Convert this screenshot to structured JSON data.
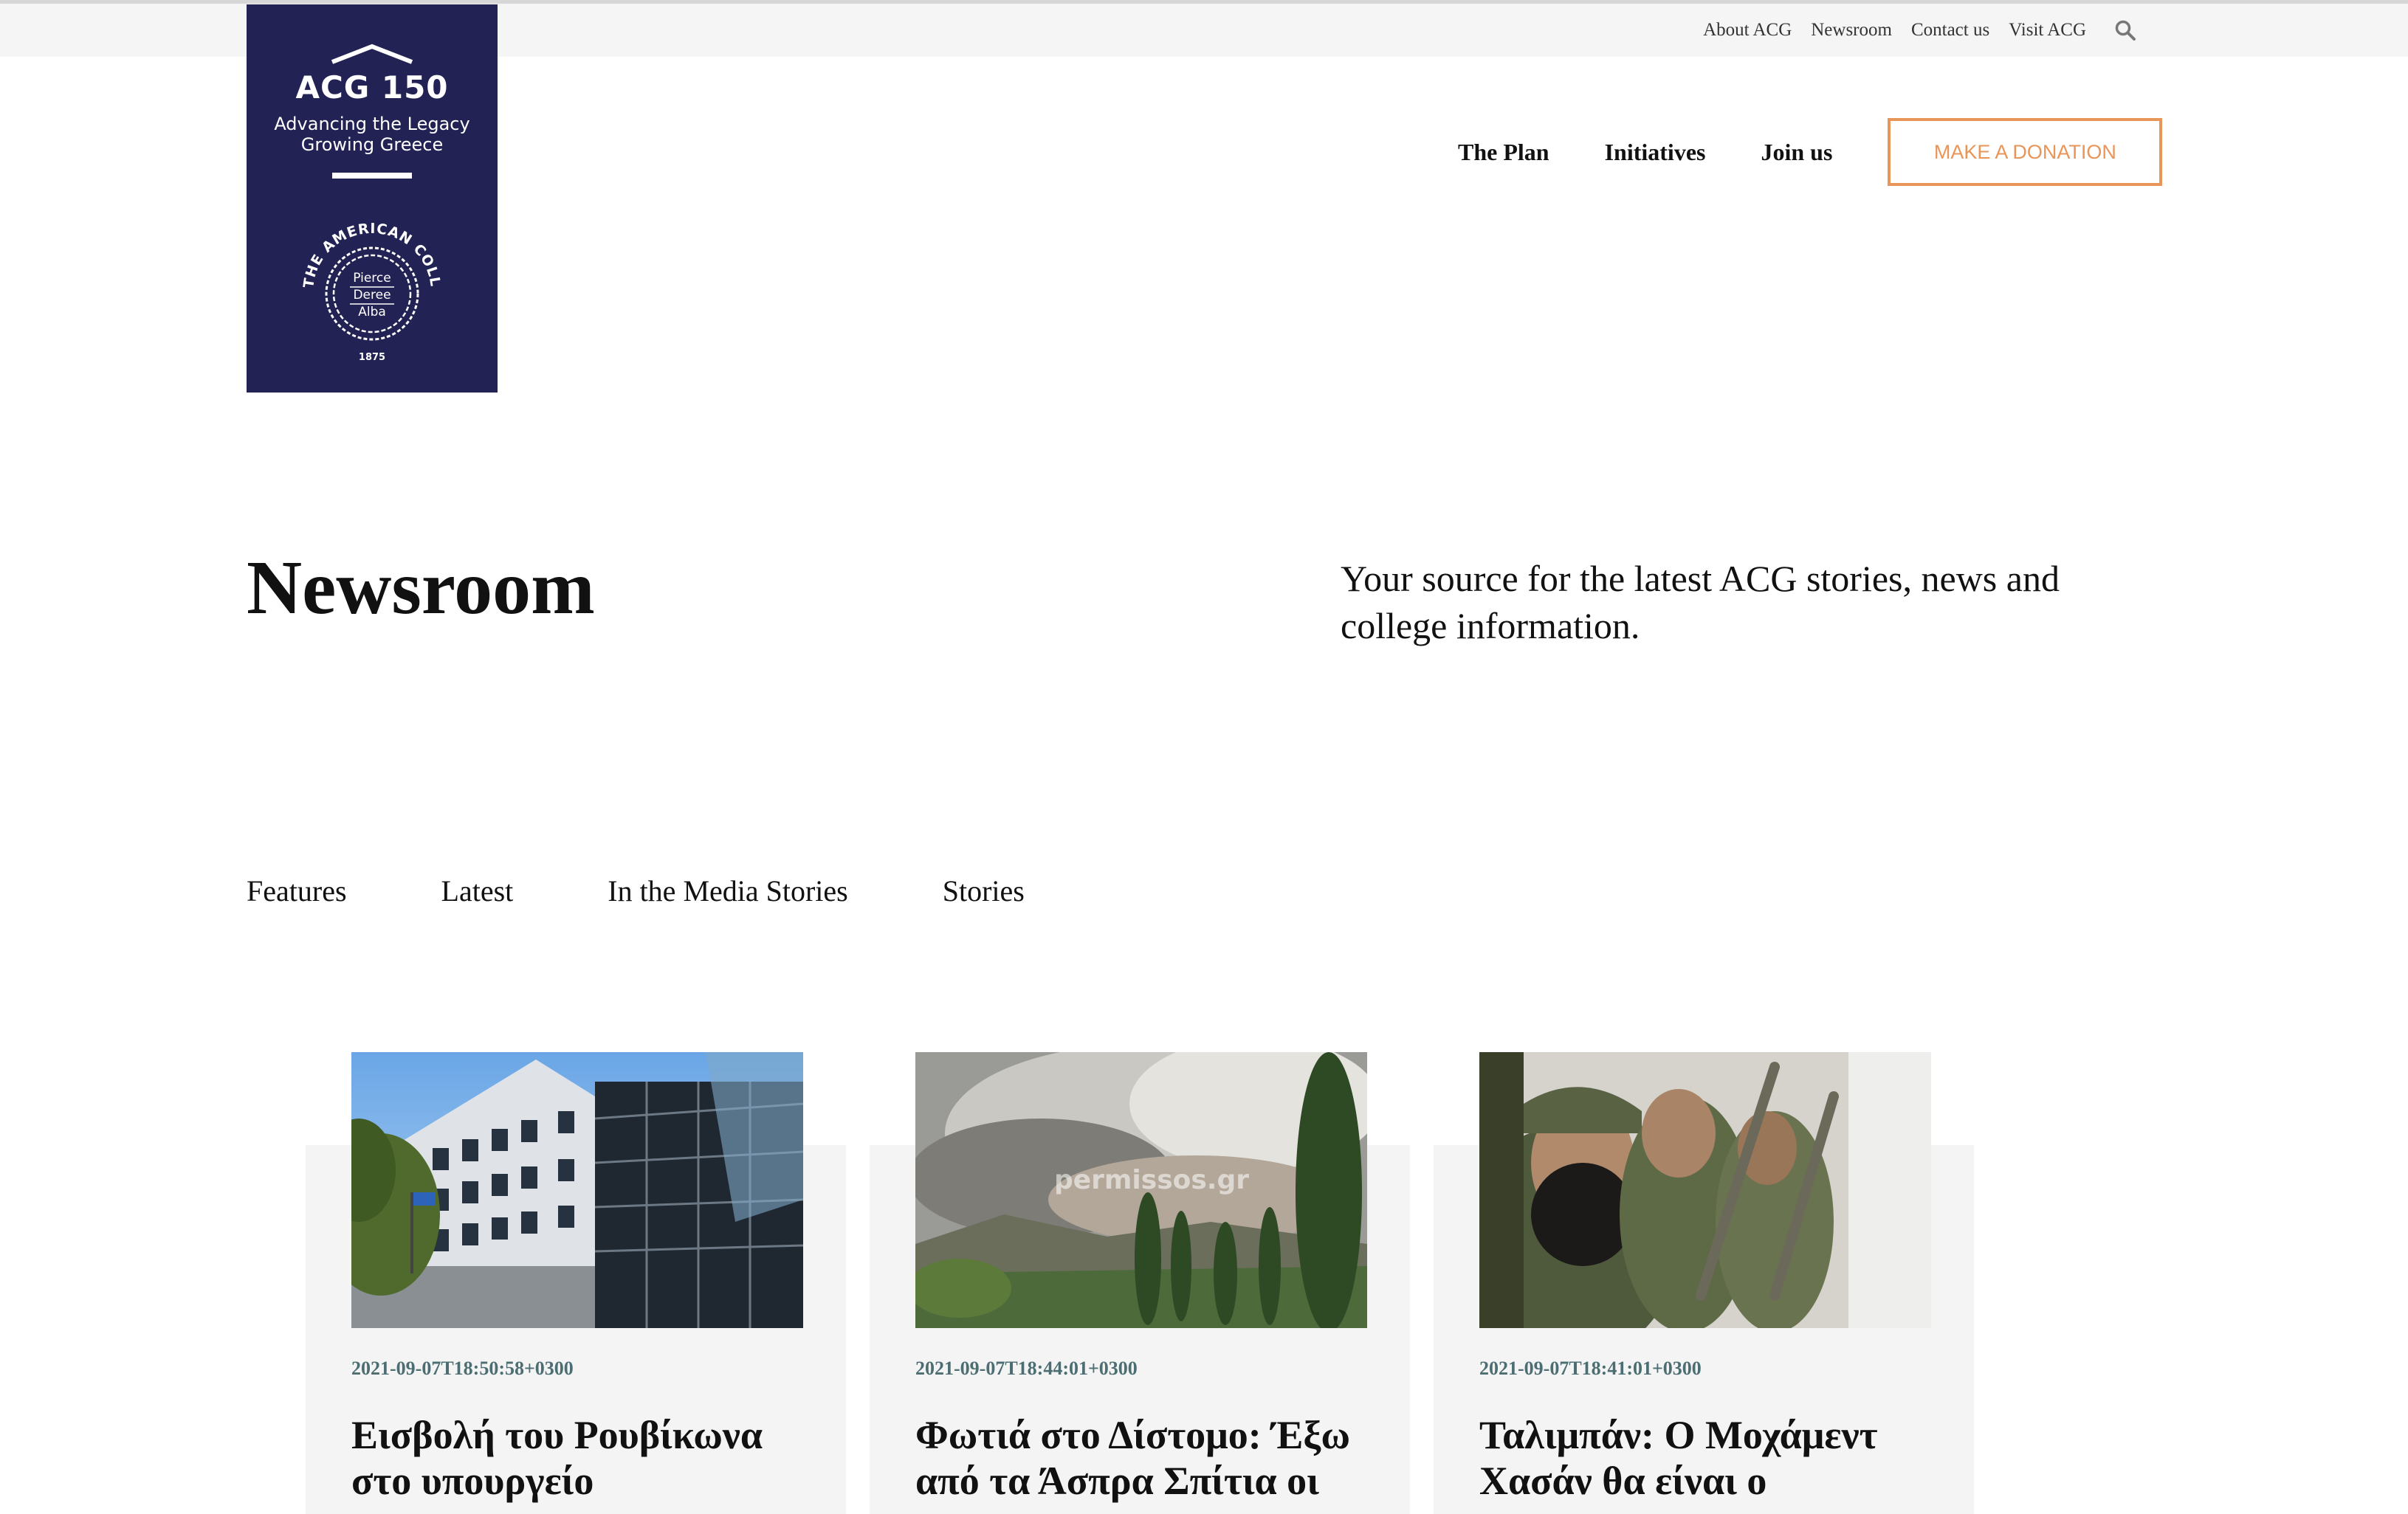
{
  "utility_nav": {
    "items": [
      "About ACG",
      "Newsroom",
      "Contact us",
      "Visit ACG"
    ],
    "search_icon": "search-icon"
  },
  "logo": {
    "brand": "ACG 150",
    "tagline_1": "Advancing the Legacy",
    "tagline_2": "Growing Greece",
    "seal_ring_text": "THE AMERICAN COLLEGE OF GREECE",
    "seal_line_1": "Pierce",
    "seal_line_2": "Deree",
    "seal_line_3": "Alba",
    "seal_year": "1875",
    "colors": {
      "background": "#222255",
      "foreground": "#ffffff"
    }
  },
  "main_nav": {
    "items": [
      "The Plan",
      "Initiatives",
      "Join us"
    ],
    "donate_label": "MAKE A DONATION",
    "donate_color": "#e8955a"
  },
  "header": {
    "title": "Newsroom",
    "description": "Your source for the latest ACG stories, news and college information."
  },
  "tabs": [
    "Features",
    "Latest",
    "In the Media Stories",
    "Stories"
  ],
  "cards": [
    {
      "image": "office-building-photo",
      "date": "2021-09-07T18:50:58+0300",
      "title": "Εισβολή του Ρουβίκωνα στο υπουργείο"
    },
    {
      "image": "wildfire-smoke-photo",
      "image_watermark": "permissos.gr",
      "date": "2021-09-07T18:44:01+0300",
      "title": "Φωτιά στο Δίστομο: Έξω από τα Άσπρα Σπίτια οι"
    },
    {
      "image": "armed-fighters-photo",
      "date": "2021-09-07T18:41:01+0300",
      "title": "Ταλιμπάν: Ο Μοχάμεντ Χασάν θα είναι ο"
    }
  ],
  "colors": {
    "accent": "#e8955a",
    "date_text": "#4c6e72",
    "card_bg": "#f4f4f4",
    "utility_bar": "#f5f5f5"
  }
}
